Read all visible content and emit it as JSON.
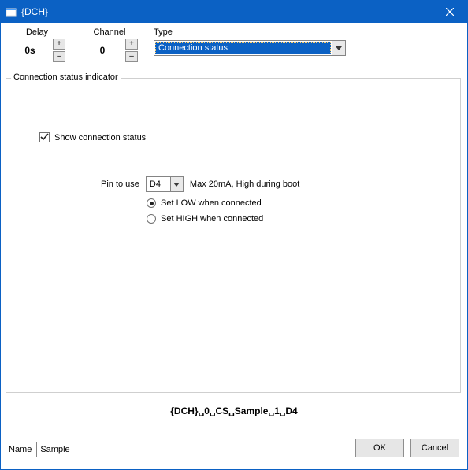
{
  "window": {
    "title": "{DCH}",
    "close_icon": "close-icon"
  },
  "top": {
    "delay": {
      "label": "Delay",
      "value": "0s"
    },
    "channel": {
      "label": "Channel",
      "value": "0"
    },
    "type": {
      "label": "Type",
      "selected": "Connection status"
    }
  },
  "group": {
    "legend": "Connection status indicator",
    "show_checkbox": {
      "checked": true,
      "label": "Show connection status"
    },
    "pin": {
      "label": "Pin to use",
      "value": "D4",
      "hint": "Max 20mA, High during boot"
    },
    "radios": {
      "low": {
        "label": "Set LOW when connected",
        "selected": true
      },
      "high": {
        "label": "Set HIGH when connected",
        "selected": false
      }
    }
  },
  "status_line": "{DCH}␣0␣CS␣Sample␣1␣D4",
  "name": {
    "label": "Name",
    "value": "Sample"
  },
  "buttons": {
    "ok": "OK",
    "cancel": "Cancel"
  },
  "spin": {
    "up": "+",
    "down": "–"
  }
}
